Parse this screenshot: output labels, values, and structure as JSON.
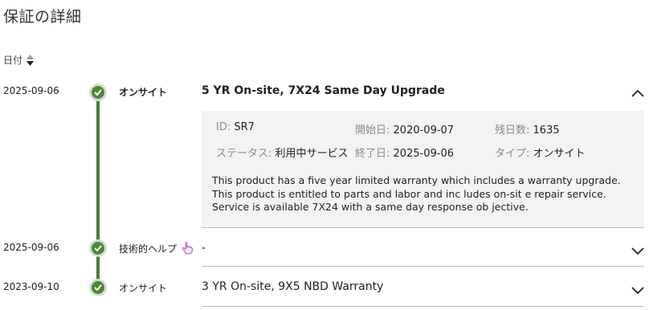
{
  "page": {
    "title": "保証の詳細"
  },
  "sort": {
    "label": "日付"
  },
  "colors": {
    "timeline": "#4c7a34",
    "check_fill": "#4a8a30",
    "panel_bg": "#f3f3f3",
    "help_icon": "#b04fb0"
  },
  "entries": [
    {
      "date": "2025-09-06",
      "type": "オンサイト",
      "summary": "5 YR On-site, 7X24 Same Day Upgrade",
      "expanded": true,
      "details": {
        "id_label": "ID:",
        "id_value": "SR7",
        "start_label": "開始日:",
        "start_value": "2020-09-07",
        "remaining_label": "残日数:",
        "remaining_value": "1635",
        "status_label": "ステータス:",
        "status_value": "利用中サービス",
        "end_label": "終了日:",
        "end_value": "2025-09-06",
        "type_label": "タイプ:",
        "type_value": "オンサイト",
        "description": "This product has a five year limited warranty which includes a warranty upgrade. This product is entitled to parts and labor and inc ludes on-sit e repair service. Service is available 7X24 with a same day response ob jective."
      }
    },
    {
      "date": "2025-09-06",
      "type": "技術的ヘルプ",
      "summary": "-",
      "expanded": false,
      "icon": "pointer-hand-icon"
    },
    {
      "date": "2023-09-10",
      "type": "オンサイト",
      "summary": "3 YR On-site, 9X5 NBD Warranty",
      "expanded": false
    }
  ]
}
